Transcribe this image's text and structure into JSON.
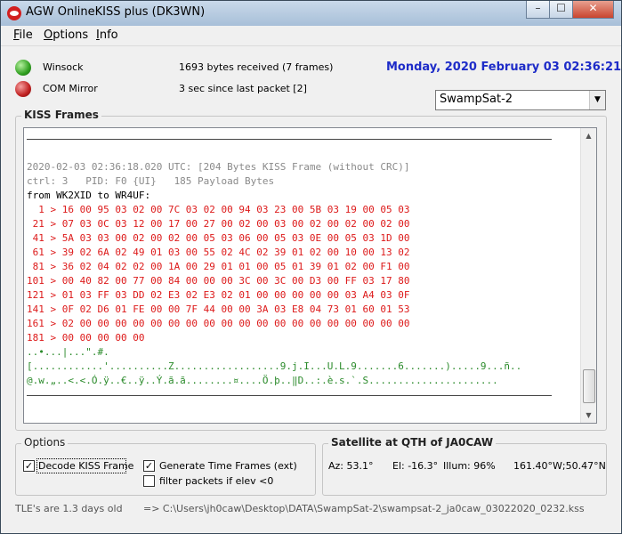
{
  "window": {
    "title": "AGW OnlineKISS plus (DK3WN)",
    "controls": {
      "minimize": "–",
      "maximize": "☐",
      "close": "✕"
    }
  },
  "menu": {
    "items": [
      {
        "label_underlined": "F",
        "label_rest": "ile"
      },
      {
        "label_underlined": "O",
        "label_rest": "ptions"
      },
      {
        "label_underlined": "I",
        "label_rest": "nfo"
      }
    ]
  },
  "status": {
    "winsock_label": "Winsock",
    "winsock_color": "#30a020",
    "com_label": "COM Mirror",
    "com_color": "#c02020",
    "bytes_received": "1693 bytes received (7 frames)",
    "since_last": "3 sec since last packet [2]",
    "datetime": "Monday, 2020 February 03  02:36:21"
  },
  "satellite_select": {
    "selected": "SwampSat-2"
  },
  "kiss_frames": {
    "title": "KISS Frames",
    "header": [
      "2020-02-03 02:36:18.020 UTC: [204 Bytes KISS Frame (without CRC)]",
      "ctrl: 3   PID: F0 {UI}   185 Payload Bytes"
    ],
    "from_line": "from WK2XID to WR4UF:",
    "hex_lines": [
      "  1 > 16 00 95 03 02 00 7C 03 02 00 94 03 23 00 5B 03 19 00 05 03",
      " 21 > 07 03 0C 03 12 00 17 00 27 00 02 00 03 00 02 00 02 00 02 00",
      " 41 > 5A 03 03 00 02 00 02 00 05 03 06 00 05 03 0E 00 05 03 1D 00",
      " 61 > 39 02 6A 02 49 01 03 00 55 02 4C 02 39 01 02 00 10 00 13 02",
      " 81 > 36 02 04 02 02 00 1A 00 29 01 01 00 05 01 39 01 02 00 F1 00",
      "101 > 00 40 82 00 77 00 84 00 00 00 3C 00 3C 00 D3 00 FF 03 17 80",
      "121 > 01 03 FF 03 DD 02 E3 02 E3 02 01 00 00 00 00 00 03 A4 03 0F",
      "141 > 0F 02 D6 01 FE 00 00 7F 44 00 00 3A 03 E8 04 73 01 60 01 53",
      "161 > 02 00 00 00 00 00 00 00 00 00 00 00 00 00 00 00 00 00 00 00",
      "181 > 00 00 00 00 00"
    ],
    "ascii_lines": [
      "..•...|...\".#.",
      "[............'..........Z..................9.j.I...U.L.9.......6.......).....9...ñ..",
      "@.w.„..<.<.Ó.ÿ..€..ÿ..Ý.ã.ã........¤....Ö.þ..‖D..:.è.s.`.S......................"
    ]
  },
  "options": {
    "title": "Options",
    "decode_kiss": {
      "label": "Decode KISS Frame",
      "checked_mark": "✓"
    },
    "generate_time": {
      "label": "Generate Time Frames (ext)",
      "checked_mark": "✓"
    },
    "filter_packets": {
      "label": "filter packets if elev <0",
      "checked_mark": ""
    }
  },
  "satellite_info": {
    "title": "Satellite at QTH of JA0CAW",
    "az": "Az: 53.1°",
    "el": "El: -16.3°",
    "illum": "Illum: 96%",
    "coords": "161.40°W;50.47°N"
  },
  "footer": {
    "tle_age": "TLE's are 1.3 days old",
    "file_path": "=> C:\\Users\\jh0caw\\Desktop\\DATA\\SwampSat-2\\swampsat-2_ja0caw_03022020_0232.kss"
  }
}
